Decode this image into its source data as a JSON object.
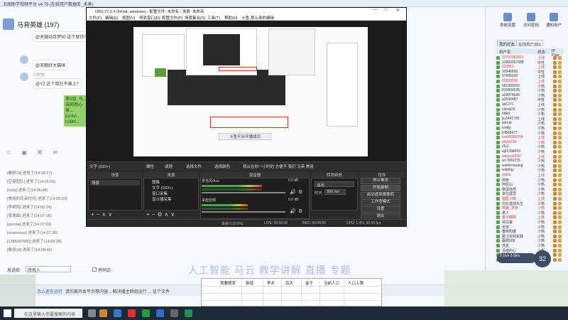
{
  "chat_app": {
    "room_title": "马背英雄 (197)",
    "messages": [
      {
        "text": "@天微动月梦90 这个就你不"
      },
      {
        "user": "",
        "text": "@天朗好大猫咪"
      },
      {
        "user": "小时怡",
        "text": "@YZ 这个用在不满上?"
      }
    ],
    "green_note": "第3组, 马... 去网用心奉... pz/4vl... n26hl..."
  },
  "chat_log": [
    "[馨厨19] 进来了(14:05:27)",
    "[空港团队] 进来了(14:05:50)",
    "[lovlz] 进来了(14:06:48)",
    "[美丽的花朵时光] 进来了(14:05:03)",
    "[李明阳] 进来了(14:05:24)",
    "[张逸霖] 进来了(14:07:08)",
    "[jacena] 进来了(14:07:09)",
    "[vivanonax] 进来了(14:07:38)",
    "[1386687000] 进来了(14:08:38)",
    "[傲羽18] 进来了(14:08:49)"
  ],
  "input_row": {
    "label": "发送给:",
    "target": "所有人",
    "checkbox": "悄悄话"
  },
  "status_row": {
    "link": "怎么还在运行",
    "hint": "请勿离开本平台等内容... 解决播主群组运行 ... 这个文件"
  },
  "right_panel": {
    "buttons": [
      {
        "label": "系统设置"
      },
      {
        "label": "访问密码"
      },
      {
        "label": "通知用户"
      }
    ],
    "tabs": [
      "我的好友",
      "在线用户(80)"
    ],
    "list_headers": [
      "用户名",
      "状态",
      "IP Flag"
    ],
    "users": [
      {
        "name": "13797365813",
        "status": "上线",
        "color": "#d33"
      },
      {
        "name": "13960057088",
        "status": "中性",
        "color": "#333"
      },
      {
        "name": "223951",
        "status": "上线",
        "color": "#d33"
      },
      {
        "name": "30946600",
        "status": "中性",
        "color": "#333"
      },
      {
        "name": "57605020",
        "status": "上线",
        "color": "#333"
      },
      {
        "name": "61220000",
        "status": "上线",
        "color": "#d33"
      },
      {
        "name": "662306002",
        "status": "少热",
        "color": "#333"
      },
      {
        "name": "810800035",
        "status": "少热",
        "color": "#333"
      },
      {
        "name": "a29874636",
        "status": "少热",
        "color": "#333"
      },
      {
        "name": "a2690487",
        "status": "中性",
        "color": "#333"
      },
      {
        "name": "ad1271",
        "status": "上线",
        "color": "#333"
      },
      {
        "name": "chinaD9",
        "status": "少热",
        "color": "#333"
      },
      {
        "name": "hdkd",
        "status": "少热",
        "color": "#333"
      },
      {
        "name": "jiu2441795",
        "status": "上线",
        "color": "#333"
      },
      {
        "name": "jetrest",
        "status": "少热",
        "color": "#333"
      },
      {
        "name": "lookly",
        "status": "少热",
        "color": "#333"
      },
      {
        "name": "li4668477",
        "status": "少热",
        "color": "#333"
      },
      {
        "name": "lovl46950704",
        "status": "上线",
        "color": "#d33"
      },
      {
        "name": "phyl4234",
        "status": "少热",
        "color": "#d33"
      },
      {
        "name": "r3y1",
        "status": "少热",
        "color": "#333"
      },
      {
        "name": "sgl1396693",
        "status": "少热",
        "color": "#333"
      },
      {
        "name": "xiaonan099",
        "status": "上线",
        "color": "#d33"
      },
      {
        "name": "wc7800275",
        "status": "少热",
        "color": "#333"
      },
      {
        "name": "wisternesang",
        "status": "少热",
        "color": "#333"
      },
      {
        "name": "wiqnhjy",
        "status": "少热",
        "color": "#333"
      },
      {
        "name": "yiyibe",
        "status": "上线",
        "color": "#d33"
      },
      {
        "name": "网管",
        "status": "少热",
        "color": "#333"
      },
      {
        "name": "阿拉山",
        "status": "少热",
        "color": "#333"
      },
      {
        "name": "傻蛋自然",
        "status": "少热",
        "color": "#333"
      },
      {
        "name": "单位成员",
        "status": "少热",
        "color": "#333"
      },
      {
        "name": "国医小田",
        "status": "上线",
        "color": "#d33"
      },
      {
        "name": "向左直前先生",
        "status": "少热",
        "color": "#333"
      },
      {
        "name": "简装_单身",
        "status": "少热",
        "color": "#d33"
      },
      {
        "name": "老人",
        "status": "少热",
        "color": "#333"
      },
      {
        "name": "金子都取",
        "status": "上线",
        "color": "#d33"
      },
      {
        "name": "快马客",
        "status": "少热",
        "color": "#333"
      },
      {
        "name": "全体",
        "status": "少热",
        "color": "#333"
      },
      {
        "name": "春晓阳度",
        "status": "少热",
        "color": "#333"
      },
      {
        "name": "蔡卫龙的实践",
        "status": "少热",
        "color": "#333"
      },
      {
        "name": "蔡郎608",
        "status": "少热",
        "color": "#333"
      },
      {
        "name": "流星",
        "status": "少热",
        "color": "#333"
      },
      {
        "name": "清澈的心",
        "status": "少热",
        "color": "#333"
      },
      {
        "name": "星辰",
        "status": "少热",
        "color": "#333"
      },
      {
        "name": "清凉的芳",
        "status": "少热",
        "color": "#333"
      }
    ],
    "volume_badge": "32",
    "meter_text": "9.1k/s 0.5k/s"
  },
  "obs": {
    "title": "OBS 27.2.4 (64-bit, windows) - 配置文件: 未命名 - 场景: 未命名",
    "menu": [
      "文件(F)",
      "编辑(E)",
      "视图(V)",
      "停靠窗口(D)",
      "配置文件(P)",
      "场景集合(S)",
      "工具(T)",
      "帮助(H)",
      "斗鱼-那么来的编辑"
    ],
    "toolbar": {
      "source_name": "文字 (GDI+)",
      "props": "属性",
      "filters": "滤镜",
      "pick_text": "选择文件",
      "pick_color": "选择颜色",
      "hint": "我从在你一小时的 方便不 我们 马英 美丽"
    },
    "docks": {
      "scenes": "场景",
      "sources": "来源",
      "mixer": "混音器",
      "transitions": "转场特效",
      "controls": "控件"
    },
    "scene_items": [
      "场景"
    ],
    "source_items": [
      "图像",
      "文字 (GDI+)",
      "窗口采集",
      "显示器采集"
    ],
    "mixer_channels": [
      {
        "name": "麦克风/Aux",
        "db": "0.0 dB",
        "level": 0.72
      },
      {
        "name": "桌面音频",
        "db": "0.0 dB",
        "level": 0.55
      }
    ],
    "transition": {
      "type": "淡出",
      "duration_label": "时长",
      "duration": "300 ms"
    },
    "controls": [
      "停止推流",
      "开始录制",
      "启动虚拟摄像机",
      "工作室模式",
      "设置",
      "退出"
    ],
    "status": {
      "live": "LIVE: 00:00:00",
      "rec": "REC: 00:00:00",
      "cpu": "CPU: 1.4%, 30.00 fps",
      "dropped": "丢帧 0 (0.0%)"
    },
    "preview_toast": "斗鱼平台开播成功",
    "selected_text": "文字 (GDI+)"
  },
  "overlay_title": "人工智能 马云 教学讲解 直播 专题",
  "sheet": {
    "headers": [
      "我要题率",
      "新增",
      "李夫",
      "后天",
      "金子",
      "当前人口",
      "人口上限"
    ]
  },
  "taskbar": {
    "search_placeholder": "在这里输入你要搜索的内容"
  }
}
